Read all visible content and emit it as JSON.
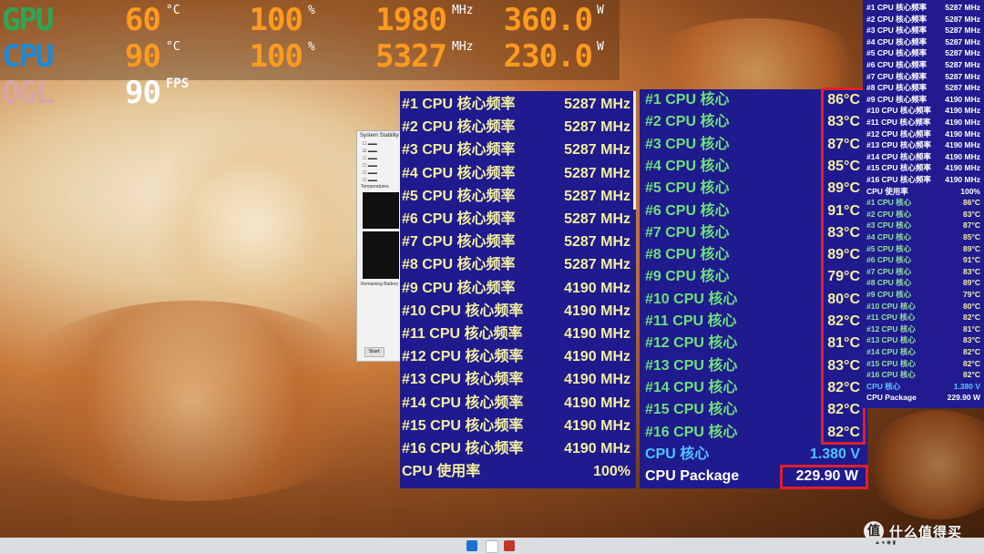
{
  "osd": {
    "rows": [
      {
        "name": "GPU",
        "name_color": "#2aa854",
        "temp": "60",
        "temp_unit": "°C",
        "load": "100",
        "load_unit": "%",
        "clock": "1980",
        "clock_unit": "MHz",
        "power": "360.0",
        "power_unit": "W"
      },
      {
        "name": "CPU",
        "name_color": "#1c8ad6",
        "temp": "90",
        "temp_unit": "°C",
        "load": "100",
        "load_unit": "%",
        "clock": "5327",
        "clock_unit": "MHz",
        "power": "230.0",
        "power_unit": "W"
      },
      {
        "name": "OGL",
        "name_color": "#d9a6a6",
        "fps": "90",
        "fps_unit": "FPS"
      }
    ]
  },
  "freq_panel": {
    "rows": [
      {
        "label": "#1 CPU 核心频率",
        "value": "5287 MHz"
      },
      {
        "label": "#2 CPU 核心频率",
        "value": "5287 MHz"
      },
      {
        "label": "#3 CPU 核心频率",
        "value": "5287 MHz"
      },
      {
        "label": "#4 CPU 核心频率",
        "value": "5287 MHz"
      },
      {
        "label": "#5 CPU 核心频率",
        "value": "5287 MHz"
      },
      {
        "label": "#6 CPU 核心频率",
        "value": "5287 MHz"
      },
      {
        "label": "#7 CPU 核心频率",
        "value": "5287 MHz"
      },
      {
        "label": "#8 CPU 核心频率",
        "value": "5287 MHz"
      },
      {
        "label": "#9 CPU 核心频率",
        "value": "4190 MHz"
      },
      {
        "label": "#10 CPU 核心频率",
        "value": "4190 MHz"
      },
      {
        "label": "#11 CPU 核心频率",
        "value": "4190 MHz"
      },
      {
        "label": "#12 CPU 核心频率",
        "value": "4190 MHz"
      },
      {
        "label": "#13 CPU 核心频率",
        "value": "4190 MHz"
      },
      {
        "label": "#14 CPU 核心频率",
        "value": "4190 MHz"
      },
      {
        "label": "#15 CPU 核心频率",
        "value": "4190 MHz"
      },
      {
        "label": "#16 CPU 核心频率",
        "value": "4190 MHz"
      },
      {
        "label": "CPU 使用率",
        "value": "100%"
      }
    ]
  },
  "temp_panel": {
    "rows": [
      {
        "label": "#1 CPU 核心",
        "value": "86°C"
      },
      {
        "label": "#2 CPU 核心",
        "value": "83°C"
      },
      {
        "label": "#3 CPU 核心",
        "value": "87°C"
      },
      {
        "label": "#4 CPU 核心",
        "value": "85°C"
      },
      {
        "label": "#5 CPU 核心",
        "value": "89°C"
      },
      {
        "label": "#6 CPU 核心",
        "value": "91°C"
      },
      {
        "label": "#7 CPU 核心",
        "value": "83°C"
      },
      {
        "label": "#8 CPU 核心",
        "value": "89°C"
      },
      {
        "label": "#9 CPU 核心",
        "value": "79°C"
      },
      {
        "label": "#10 CPU 核心",
        "value": "80°C"
      },
      {
        "label": "#11 CPU 核心",
        "value": "82°C"
      },
      {
        "label": "#12 CPU 核心",
        "value": "81°C"
      },
      {
        "label": "#13 CPU 核心",
        "value": "83°C"
      },
      {
        "label": "#14 CPU 核心",
        "value": "82°C"
      },
      {
        "label": "#15 CPU 核心",
        "value": "82°C"
      },
      {
        "label": "#16 CPU 核心",
        "value": "82°C"
      }
    ],
    "voltage": {
      "label": "CPU 核心",
      "value": "1.380 V"
    },
    "package": {
      "label": "CPU Package",
      "value": "229.90 W"
    }
  },
  "right_list": {
    "freq": [
      {
        "label": "#1 CPU 核心频率",
        "value": "5287 MHz"
      },
      {
        "label": "#2 CPU 核心频率",
        "value": "5287 MHz"
      },
      {
        "label": "#3 CPU 核心频率",
        "value": "5287 MHz"
      },
      {
        "label": "#4 CPU 核心频率",
        "value": "5287 MHz"
      },
      {
        "label": "#5 CPU 核心频率",
        "value": "5287 MHz"
      },
      {
        "label": "#6 CPU 核心频率",
        "value": "5287 MHz"
      },
      {
        "label": "#7 CPU 核心频率",
        "value": "5287 MHz"
      },
      {
        "label": "#8 CPU 核心频率",
        "value": "5287 MHz"
      },
      {
        "label": "#9 CPU 核心频率",
        "value": "4190 MHz"
      },
      {
        "label": "#10 CPU 核心频率",
        "value": "4190 MHz"
      },
      {
        "label": "#11 CPU 核心频率",
        "value": "4190 MHz"
      },
      {
        "label": "#12 CPU 核心频率",
        "value": "4190 MHz"
      },
      {
        "label": "#13 CPU 核心频率",
        "value": "4190 MHz"
      },
      {
        "label": "#14 CPU 核心频率",
        "value": "4190 MHz"
      },
      {
        "label": "#15 CPU 核心频率",
        "value": "4190 MHz"
      },
      {
        "label": "#16 CPU 核心频率",
        "value": "4190 MHz"
      }
    ],
    "usage": {
      "label": "CPU 使用率",
      "value": "100%"
    },
    "temps": [
      {
        "label": "#1 CPU 核心",
        "value": "86°C"
      },
      {
        "label": "#2 CPU 核心",
        "value": "83°C"
      },
      {
        "label": "#3 CPU 核心",
        "value": "87°C"
      },
      {
        "label": "#4 CPU 核心",
        "value": "85°C"
      },
      {
        "label": "#5 CPU 核心",
        "value": "89°C"
      },
      {
        "label": "#6 CPU 核心",
        "value": "91°C"
      },
      {
        "label": "#7 CPU 核心",
        "value": "83°C"
      },
      {
        "label": "#8 CPU 核心",
        "value": "89°C"
      },
      {
        "label": "#9 CPU 核心",
        "value": "79°C"
      },
      {
        "label": "#10 CPU 核心",
        "value": "80°C"
      },
      {
        "label": "#11 CPU 核心",
        "value": "82°C"
      },
      {
        "label": "#12 CPU 核心",
        "value": "81°C"
      },
      {
        "label": "#13 CPU 核心",
        "value": "83°C"
      },
      {
        "label": "#14 CPU 核心",
        "value": "82°C"
      },
      {
        "label": "#15 CPU 核心",
        "value": "82°C"
      },
      {
        "label": "#16 CPU 核心",
        "value": "82°C"
      }
    ],
    "voltage": {
      "label": "CPU 核心",
      "value": "1.380 V"
    },
    "package": {
      "label": "CPU Package",
      "value": "229.90 W"
    }
  },
  "stability_window": {
    "title": "System Stability",
    "temperatures_label": "Temperatures",
    "remaining_label": "Remaining Battery",
    "start_label": "Start"
  },
  "watermark": {
    "logo": "值",
    "text": "什么值得买"
  },
  "colors": {
    "panel_bg": "#1f1a8e",
    "freq_text": "#f3f0a0",
    "temp_label": "#6fe07a",
    "highlight_border": "#e0202a",
    "osd_value": "#ff9a1e"
  }
}
